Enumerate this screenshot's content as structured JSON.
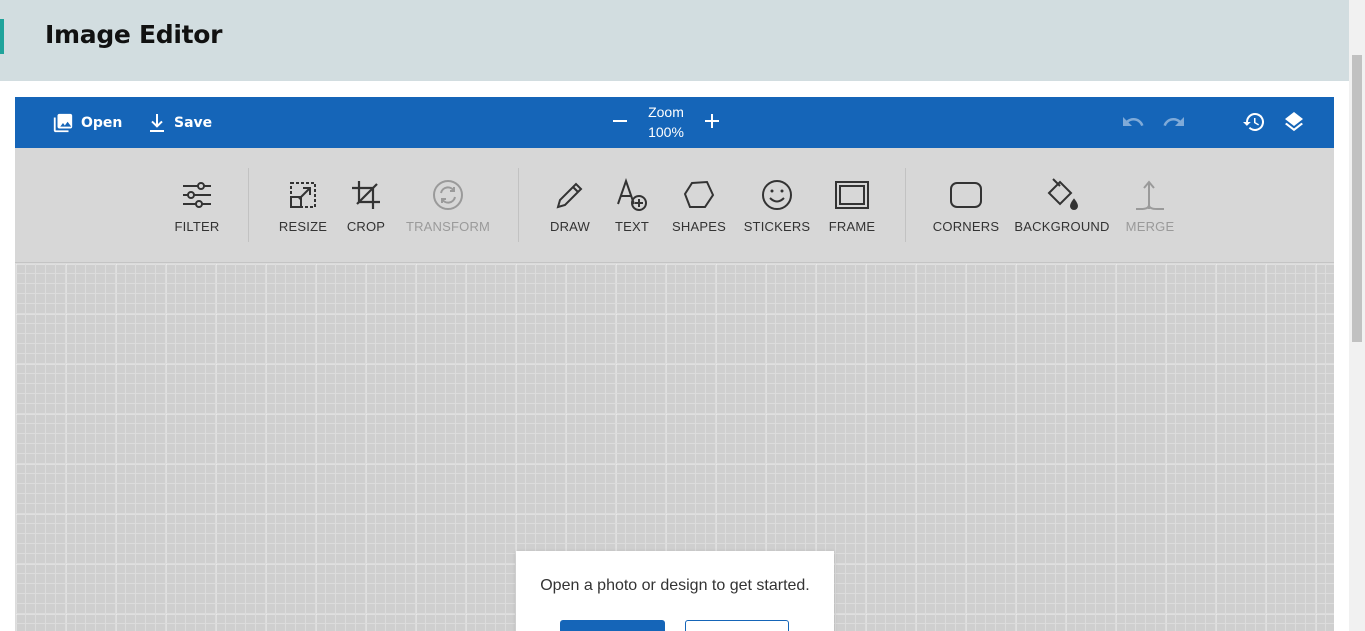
{
  "page": {
    "title": "Image Editor"
  },
  "topbar": {
    "open_label": "Open",
    "save_label": "Save",
    "zoom_label": "Zoom",
    "zoom_value": "100%",
    "zoom_out_icon": "minus-icon",
    "zoom_in_icon": "plus-icon",
    "undo_icon": "undo-icon",
    "redo_icon": "redo-icon",
    "history_icon": "history-icon",
    "layers_icon": "layers-icon",
    "background_color": "#1565b8"
  },
  "toolbar": {
    "tools": [
      {
        "label": "FILTER",
        "icon": "sliders-icon",
        "disabled": false
      },
      {
        "label": "RESIZE",
        "icon": "resize-icon",
        "disabled": false
      },
      {
        "label": "CROP",
        "icon": "crop-icon",
        "disabled": false
      },
      {
        "label": "TRANSFORM",
        "icon": "rotate-icon",
        "disabled": true
      },
      {
        "label": "DRAW",
        "icon": "pencil-icon",
        "disabled": false
      },
      {
        "label": "TEXT",
        "icon": "text-add-icon",
        "disabled": false
      },
      {
        "label": "SHAPES",
        "icon": "polygon-icon",
        "disabled": false
      },
      {
        "label": "STICKERS",
        "icon": "smiley-icon",
        "disabled": false
      },
      {
        "label": "FRAME",
        "icon": "frame-icon",
        "disabled": false
      },
      {
        "label": "CORNERS",
        "icon": "rounded-rect-icon",
        "disabled": false
      },
      {
        "label": "BACKGROUND",
        "icon": "paint-bucket-icon",
        "disabled": false
      },
      {
        "label": "MERGE",
        "icon": "merge-icon",
        "disabled": true
      }
    ]
  },
  "dialog": {
    "message": "Open a photo or design to get started."
  },
  "colors": {
    "header_bg": "#d2dde0",
    "accent": "#20a39b",
    "toolbar_bg": "#d7d7d7",
    "canvas_bg": "#cfcfcf"
  }
}
